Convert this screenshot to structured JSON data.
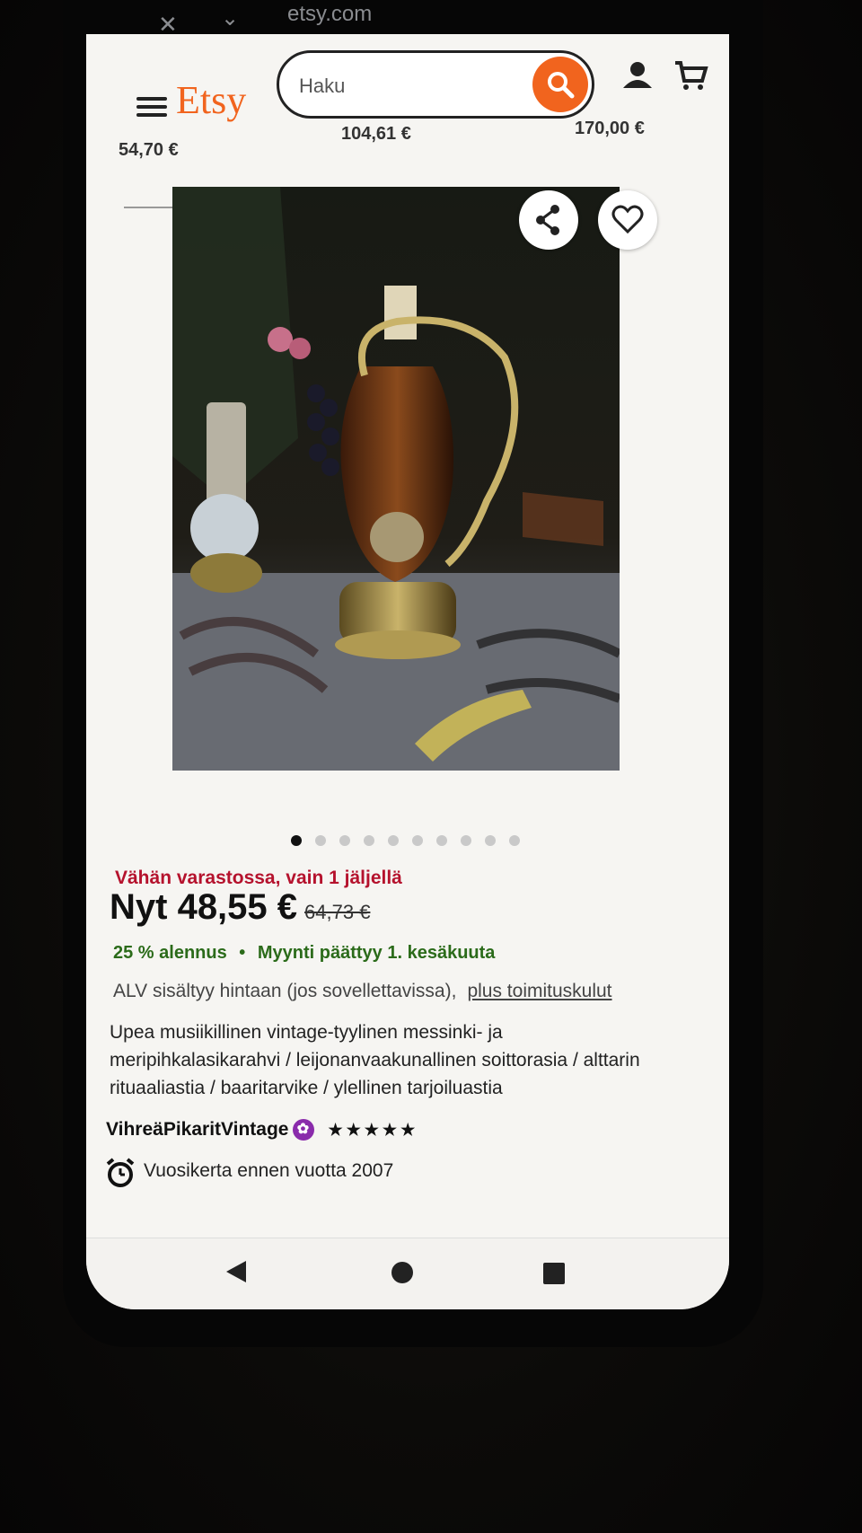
{
  "browser": {
    "url": "etsy.com"
  },
  "header": {
    "logo": "Etsy",
    "search_placeholder": "Haku"
  },
  "related_prices": [
    "54,70 €",
    "104,61 €",
    "170,00 €"
  ],
  "gallery": {
    "image_count": 10,
    "active_index": 0
  },
  "listing": {
    "stock_notice": "Vähän varastossa, vain 1 jäljellä",
    "price_now": "Nyt 48,55 €",
    "price_old": "64,73 €",
    "discount": "25 % alennus",
    "sale_separator": "•",
    "sale_end": "Myynti päättyy 1. kesäkuuta",
    "vat_text": "ALV sisältyy hintaan (jos sovellettavissa),",
    "shipping_link": "plus toimituskulut",
    "title": "Upea musiikillinen vintage-tyylinen messinki- ja meripihkalasikarahvi / leijonanvaakunallinen soittorasia / alttarin rituaaliastia / baaritarvike / ylellinen tarjoiluastia",
    "seller": "VihreäPikaritVintage",
    "rating": 5,
    "vintage_note": "Vuosikerta ennen vuotta 2007"
  },
  "colors": {
    "brand": "#f1641e",
    "stock": "#b5122d",
    "sale": "#2b6b1a",
    "star_seller": "#8a2bab"
  }
}
